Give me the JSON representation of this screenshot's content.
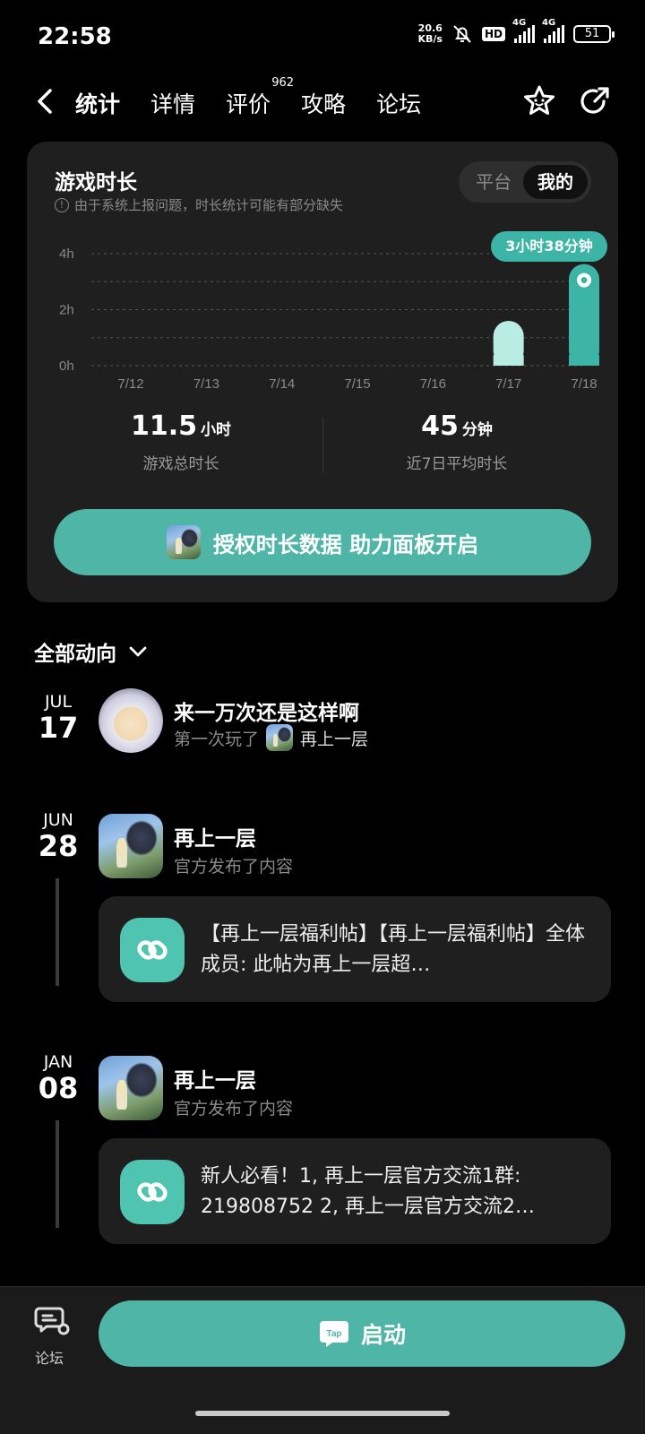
{
  "status_bar": {
    "time": "22:58",
    "net_speed_value": "20.6",
    "net_speed_unit": "KB/s",
    "hd_badge": "HD",
    "network_1": "4G",
    "network_2": "4G",
    "battery": "51"
  },
  "header": {
    "tabs": [
      {
        "label": "统计",
        "active": true
      },
      {
        "label": "详情",
        "active": false
      },
      {
        "label": "评价",
        "active": false,
        "badge": "962"
      },
      {
        "label": "攻略",
        "active": false
      },
      {
        "label": "论坛",
        "active": false
      }
    ],
    "icons": [
      "back-arrow-icon",
      "star-face-icon",
      "share-icon"
    ]
  },
  "stats_card": {
    "title": "游戏时长",
    "note": "由于系统上报问题，时长统计可能有部分缺失",
    "toggle": {
      "off_label": "平台",
      "on_label": "我的"
    },
    "tooltip": "3小时38分钟",
    "total": {
      "value": "11.5",
      "unit": "小时",
      "label": "游戏总时长"
    },
    "average": {
      "value": "45",
      "unit": "分钟",
      "label": "近7日平均时长"
    },
    "auth_button": "授权时长数据 助力面板开启"
  },
  "chart_data": {
    "type": "bar",
    "categories": [
      "7/12",
      "7/13",
      "7/14",
      "7/15",
      "7/16",
      "7/17",
      "7/18"
    ],
    "values": [
      0,
      0,
      0,
      0,
      0,
      1.6,
      3.63
    ],
    "y_ticks": [
      "4h",
      "2h",
      "0h"
    ],
    "ylim": [
      0,
      4
    ],
    "grid": true,
    "highlight_index": 6,
    "colors": {
      "highlight": "#3db5a6",
      "normal": "#b9ece3"
    }
  },
  "feed": {
    "header": "全部动向",
    "entries": [
      {
        "month": "JUL",
        "day": "17",
        "title": "来一万次还是这样啊",
        "sub_prefix": "第一次玩了",
        "sub_game": "再上一层"
      },
      {
        "month": "JUN",
        "day": "28",
        "title": "再上一层",
        "sub": "官方发布了内容",
        "post": "【再上一层福利帖】【再上一层福利帖】全体成员: 此帖为再上一层超…"
      },
      {
        "month": "JAN",
        "day": "08",
        "title": "再上一层",
        "sub": "官方发布了内容",
        "post": "新人必看！1, 再上一层官方交流1群: 219808752 2, 再上一层官方交流2…"
      }
    ]
  },
  "bottom_bar": {
    "forum_label": "论坛",
    "launch_label": "启动",
    "tap_logo": "Tap"
  },
  "accent_color": "#4fb5a6"
}
